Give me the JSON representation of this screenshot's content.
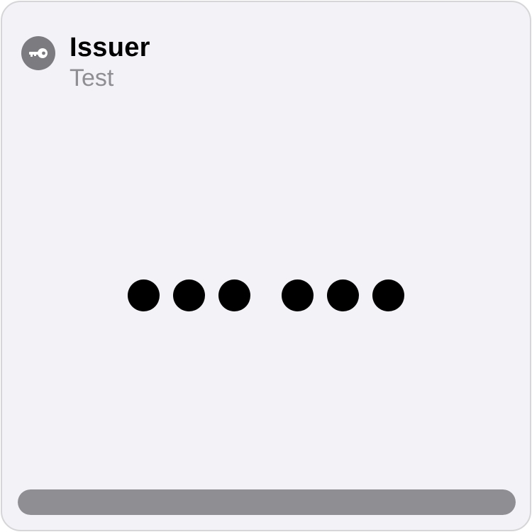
{
  "card": {
    "issuer": "Issuer",
    "account": "Test",
    "icon": "key-icon",
    "code_groups": [
      3,
      3
    ],
    "code_hidden": true,
    "progress": 1.0
  },
  "colors": {
    "background": "#f2f2f7",
    "icon_background": "#7c7c80",
    "secondary_text": "#8e8e93",
    "progress_fill": "#8e8e93"
  }
}
